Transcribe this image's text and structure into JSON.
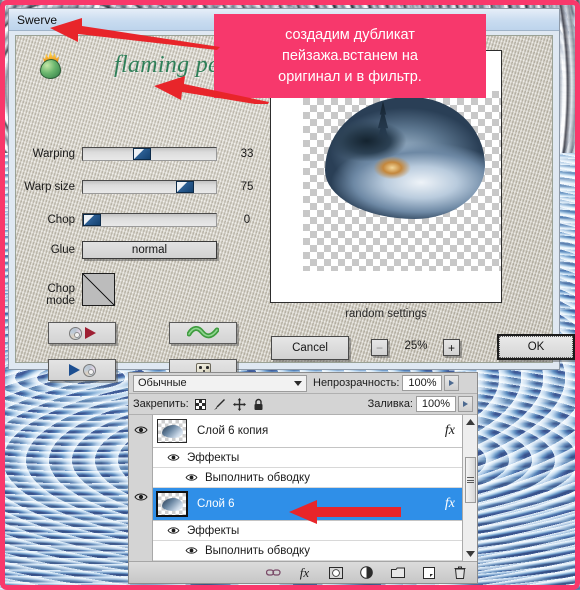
{
  "window": {
    "title": "Swerve",
    "brand": "flaming pear"
  },
  "callout": {
    "line1": "создадим дубликат",
    "line2": "пейзажа.встанем на",
    "line3": "оригинал и в фильтр."
  },
  "filter": {
    "sliders": [
      {
        "label": "Warping",
        "value": "33",
        "percent": 33
      },
      {
        "label": "Warp size",
        "value": "75",
        "percent": 75
      },
      {
        "label": "Chop",
        "value": "0",
        "percent": 0
      }
    ],
    "glue": {
      "label": "Glue",
      "value": "normal"
    },
    "chop_mode": {
      "label": "Chop mode"
    },
    "preview_caption": "random settings",
    "buttons": {
      "cancel": "Cancel",
      "ok": "OK",
      "zoom_out": "−",
      "zoom_in": "+",
      "zoom_level": "25%"
    },
    "icon_buttons": [
      {
        "name": "load-settings"
      },
      {
        "name": "save-settings"
      },
      {
        "name": "preset-squiggle"
      },
      {
        "name": "randomize-dice"
      }
    ]
  },
  "layers_panel": {
    "blend_mode": "Обычные",
    "opacity_label": "Непрозрачность:",
    "opacity_value": "100%",
    "lock_label": "Закрепить:",
    "fill_label": "Заливка:",
    "fill_value": "100%",
    "lock_icons": [
      "transparency-lock-icon",
      "paint-lock-icon",
      "move-lock-icon",
      "all-lock-icon"
    ],
    "layers": [
      {
        "name": "Слой 6 копия",
        "selected": false,
        "fx": "fx",
        "effects_group": "Эффекты",
        "effects": [
          "Выполнить обводку"
        ]
      },
      {
        "name": "Слой 6",
        "selected": true,
        "fx": "fx",
        "effects_group": "Эффекты",
        "effects": [
          "Выполнить обводку"
        ]
      }
    ],
    "footer_icons": [
      "link-layers-icon",
      "add-style-icon",
      "add-mask-icon",
      "adjustment-layer-icon",
      "new-group-icon",
      "new-layer-icon",
      "delete-layer-icon"
    ]
  },
  "colors": {
    "accent_pink": "#f7386c",
    "selection_blue": "#2f8fe8",
    "brand_green": "#2f7f58",
    "arrow_red": "#e8252a"
  }
}
